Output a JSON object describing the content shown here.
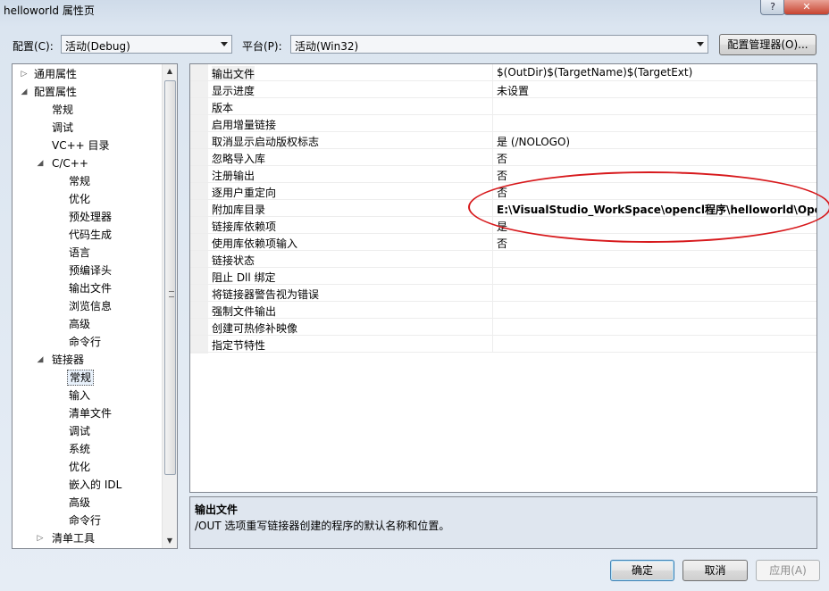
{
  "window": {
    "title": "helloworld 属性页",
    "help_label": "?",
    "close_label": "✕"
  },
  "config": {
    "config_label": "配置(C):",
    "config_value": "活动(Debug)",
    "platform_label": "平台(P):",
    "platform_value": "活动(Win32)",
    "manager_button": "配置管理器(O)..."
  },
  "tree": {
    "items": [
      {
        "label": "通用属性",
        "expander": "▷"
      },
      {
        "label": "配置属性",
        "expander": "◢"
      },
      {
        "label": "常规",
        "expander": ""
      },
      {
        "label": "调试",
        "expander": ""
      },
      {
        "label": "VC++ 目录",
        "expander": ""
      },
      {
        "label": "C/C++",
        "expander": "◢"
      },
      {
        "label": "常规",
        "expander": ""
      },
      {
        "label": "优化",
        "expander": ""
      },
      {
        "label": "预处理器",
        "expander": ""
      },
      {
        "label": "代码生成",
        "expander": ""
      },
      {
        "label": "语言",
        "expander": ""
      },
      {
        "label": "预编译头",
        "expander": ""
      },
      {
        "label": "输出文件",
        "expander": ""
      },
      {
        "label": "浏览信息",
        "expander": ""
      },
      {
        "label": "高级",
        "expander": ""
      },
      {
        "label": "命令行",
        "expander": ""
      },
      {
        "label": "链接器",
        "expander": "◢"
      },
      {
        "label": "常规",
        "expander": ""
      },
      {
        "label": "输入",
        "expander": ""
      },
      {
        "label": "清单文件",
        "expander": ""
      },
      {
        "label": "调试",
        "expander": ""
      },
      {
        "label": "系统",
        "expander": ""
      },
      {
        "label": "优化",
        "expander": ""
      },
      {
        "label": "嵌入的 IDL",
        "expander": ""
      },
      {
        "label": "高级",
        "expander": ""
      },
      {
        "label": "命令行",
        "expander": ""
      },
      {
        "label": "清单工具",
        "expander": "▷"
      }
    ]
  },
  "properties": {
    "rows": [
      {
        "name": "输出文件",
        "value": "$(OutDir)$(TargetName)$(TargetExt)"
      },
      {
        "name": "显示进度",
        "value": "未设置"
      },
      {
        "name": "版本",
        "value": ""
      },
      {
        "name": "启用增量链接",
        "value": ""
      },
      {
        "name": "取消显示启动版权标志",
        "value": "是 (/NOLOGO)"
      },
      {
        "name": "忽略导入库",
        "value": "否"
      },
      {
        "name": "注册输出",
        "value": "否"
      },
      {
        "name": "逐用户重定向",
        "value": "否"
      },
      {
        "name": "附加库目录",
        "value": "E:\\VisualStudio_WorkSpace\\opencl程序\\helloworld\\OpenCl"
      },
      {
        "name": "链接库依赖项",
        "value": "是"
      },
      {
        "name": "使用库依赖项输入",
        "value": "否"
      },
      {
        "name": "链接状态",
        "value": ""
      },
      {
        "name": "阻止 Dll 绑定",
        "value": ""
      },
      {
        "name": "将链接器警告视为错误",
        "value": ""
      },
      {
        "name": "强制文件输出",
        "value": ""
      },
      {
        "name": "创建可热修补映像",
        "value": ""
      },
      {
        "name": "指定节特性",
        "value": ""
      }
    ]
  },
  "description": {
    "title": "输出文件",
    "text": "/OUT 选项重写链接器创建的程序的默认名称和位置。"
  },
  "buttons": {
    "ok": "确定",
    "cancel": "取消",
    "apply": "应用(A)"
  },
  "colors": {
    "annotation": "#d7191c"
  }
}
